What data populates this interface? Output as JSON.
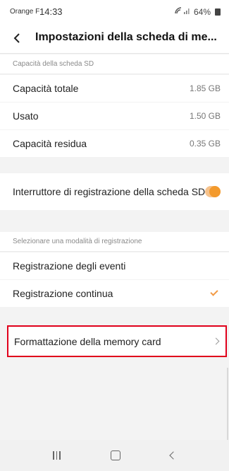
{
  "status_bar": {
    "carrier": "Orange F",
    "time": "14:33",
    "battery": "64%"
  },
  "header": {
    "title": "Impostazioni della scheda di me..."
  },
  "capacity_section": {
    "header": "Capacità della scheda SD",
    "rows": [
      {
        "label": "Capacità totale",
        "value": "1.85 GB"
      },
      {
        "label": "Usato",
        "value": "1.50 GB"
      },
      {
        "label": "Capacità residua",
        "value": "0.35 GB"
      }
    ]
  },
  "recording_switch": {
    "label": "Interruttore di registrazione della scheda SD",
    "enabled": true,
    "accent_color": "#f39a2d"
  },
  "mode_section": {
    "header": "Selezionare una modalità di registrazione",
    "options": [
      {
        "label": "Registrazione degli eventi",
        "selected": false
      },
      {
        "label": "Registrazione continua",
        "selected": true
      }
    ]
  },
  "format_card": {
    "label": "Formattazione della memory card",
    "highlight_color": "#e0001b"
  },
  "icons": {
    "back": "chevron-left-icon",
    "signal": "signal-icon",
    "wifi": "wifi-icon",
    "battery": "battery-icon",
    "check": "checkmark-icon",
    "chevron": "chevron-right-icon"
  }
}
